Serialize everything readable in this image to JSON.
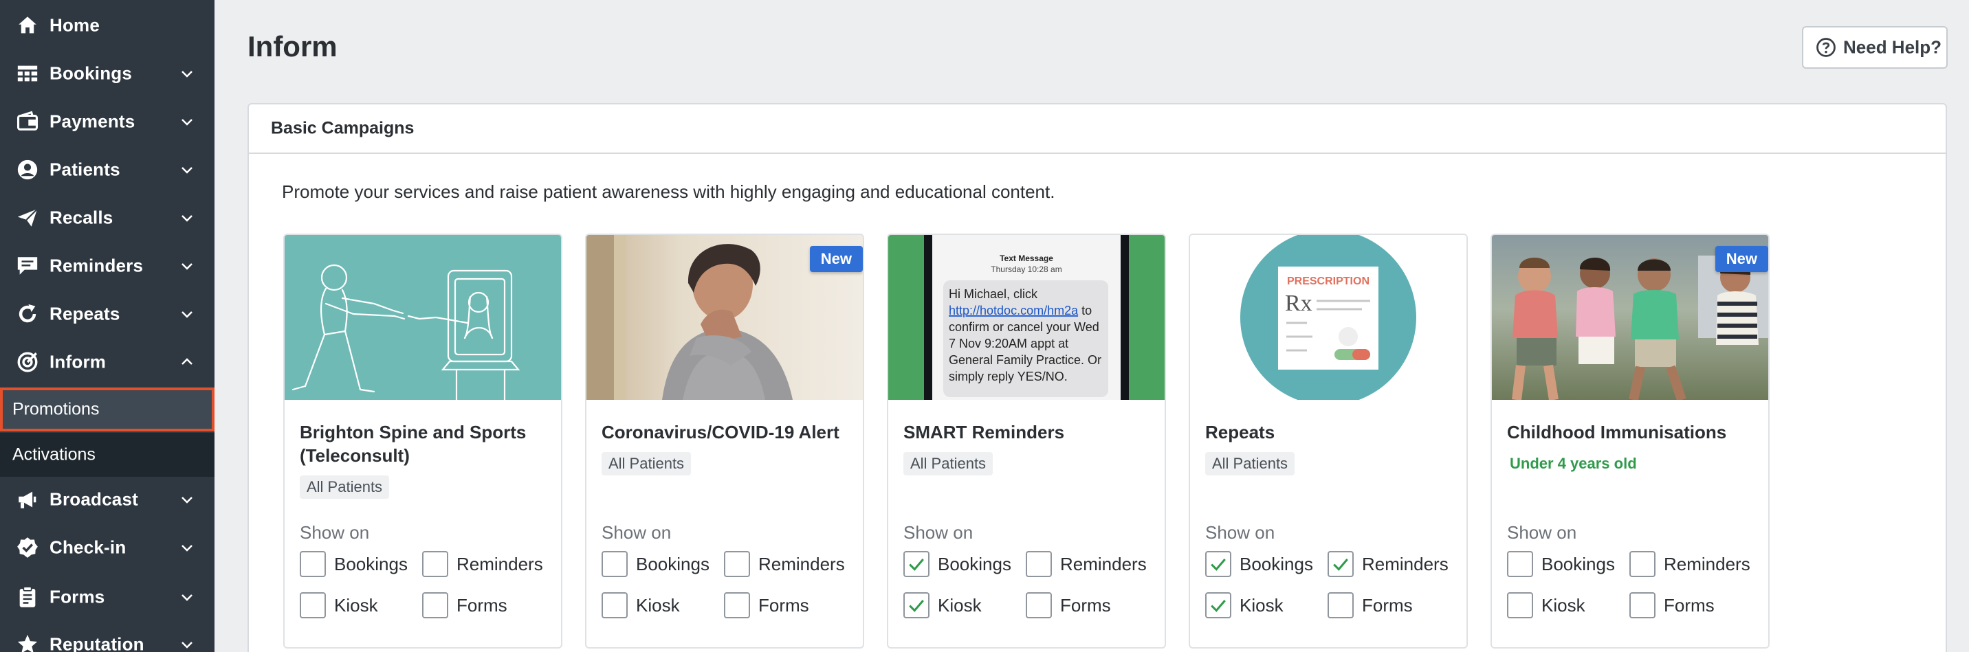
{
  "sidebar": {
    "items": [
      {
        "label": "Home",
        "icon": "home-icon",
        "chevron": "none"
      },
      {
        "label": "Bookings",
        "icon": "grid-icon",
        "chevron": "down"
      },
      {
        "label": "Payments",
        "icon": "wallet-icon",
        "chevron": "down"
      },
      {
        "label": "Patients",
        "icon": "user-circle-icon",
        "chevron": "down"
      },
      {
        "label": "Recalls",
        "icon": "paper-plane-icon",
        "chevron": "down"
      },
      {
        "label": "Reminders",
        "icon": "chat-icon",
        "chevron": "down"
      },
      {
        "label": "Repeats",
        "icon": "refresh-icon",
        "chevron": "down"
      },
      {
        "label": "Inform",
        "icon": "target-icon",
        "chevron": "up"
      },
      {
        "label": "Broadcast",
        "icon": "megaphone-icon",
        "chevron": "down"
      },
      {
        "label": "Check-in",
        "icon": "check-badge-icon",
        "chevron": "down"
      },
      {
        "label": "Forms",
        "icon": "clipboard-icon",
        "chevron": "down"
      },
      {
        "label": "Reputation",
        "icon": "star-icon",
        "chevron": "down"
      }
    ],
    "sub_items": [
      {
        "label": "Promotions",
        "active": true
      },
      {
        "label": "Activations",
        "active": false
      }
    ]
  },
  "header": {
    "title": "Inform",
    "help_label": "Need Help?"
  },
  "panel": {
    "title": "Basic Campaigns",
    "description": "Promote your services and raise patient awareness with highly engaging and educational content.",
    "show_on_label": "Show on",
    "cards": [
      {
        "title": "Brighton Spine and Sports (Teleconsult)",
        "tag": "All Patients",
        "tag_style": "grey",
        "badge": "",
        "image": "teleconsult-illustration",
        "checks": {
          "Bookings": false,
          "Reminders": false,
          "Kiosk": false,
          "Forms": false
        }
      },
      {
        "title": "Coronavirus/COVID-19 Alert",
        "tag": "All Patients",
        "tag_style": "grey",
        "badge": "New",
        "image": "coughing-woman-photo",
        "checks": {
          "Bookings": false,
          "Reminders": false,
          "Kiosk": false,
          "Forms": false
        }
      },
      {
        "title": "SMART Reminders",
        "tag": "All Patients",
        "tag_style": "grey",
        "badge": "",
        "image": "sms-phone",
        "sms": {
          "header": "Text Message",
          "time": "Thursday 10:28 am",
          "line1": "Hi Michael, click",
          "link": "http://hotdoc.com/hm2a",
          "link_suffix": " to",
          "line3": "confirm or cancel your Wed",
          "line4": "7 Nov 9:20AM appt at",
          "line5": "General Family Practice. Or",
          "line6": "simply reply YES/NO."
        },
        "checks": {
          "Bookings": true,
          "Reminders": false,
          "Kiosk": true,
          "Forms": false
        }
      },
      {
        "title": "Repeats",
        "tag": "All Patients",
        "tag_style": "grey",
        "badge": "",
        "image": "prescription-illustration",
        "rx_heading": "PRESCRIPTION",
        "rx_symbol": "Rx",
        "checks": {
          "Bookings": true,
          "Reminders": true,
          "Kiosk": true,
          "Forms": false
        }
      },
      {
        "title": "Childhood Immunisations",
        "tag": "Under 4 years old",
        "tag_style": "green",
        "badge": "New",
        "image": "children-running-photo",
        "checks": {
          "Bookings": false,
          "Reminders": false,
          "Kiosk": false,
          "Forms": false
        }
      }
    ],
    "check_labels": [
      "Bookings",
      "Reminders",
      "Kiosk",
      "Forms"
    ]
  },
  "colors": {
    "sidebar_bg": "#2f3841",
    "sub_bg": "#1f272e",
    "active_outline": "#e4502b",
    "badge_blue": "#2f6fd6",
    "check_green": "#2f9b4a",
    "teal": "#5fb4b0"
  }
}
